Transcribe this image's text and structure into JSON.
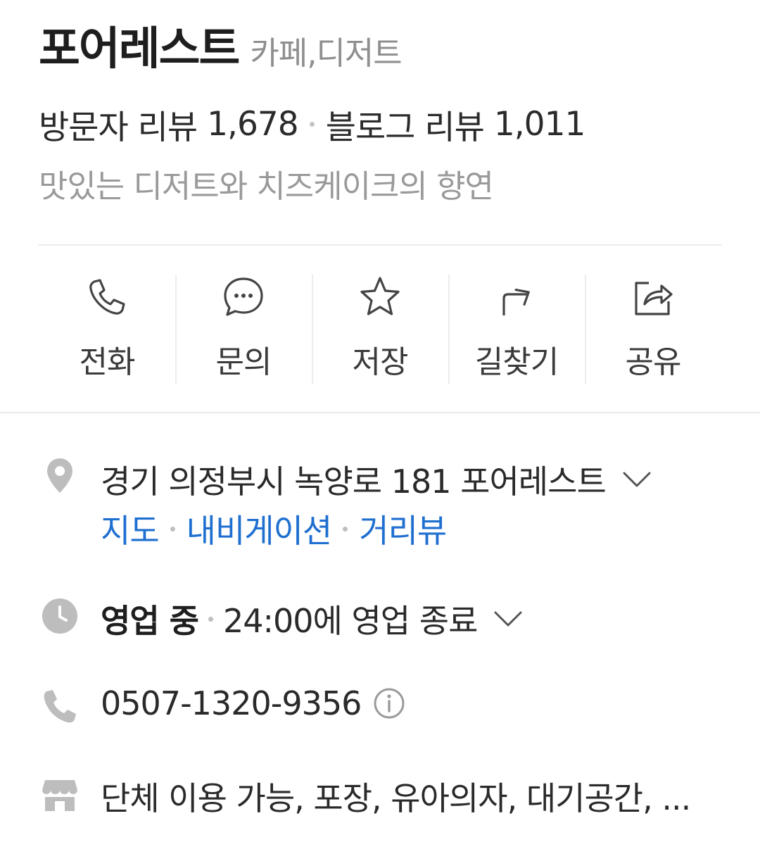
{
  "header": {
    "name": "포어레스트",
    "category": "카페,디저트",
    "visitor_review_label": "방문자 리뷰",
    "visitor_review_count": "1,678",
    "blog_review_label": "블로그 리뷰",
    "blog_review_count": "1,011",
    "description": "맛있는 디저트와 치즈케이크의 향연"
  },
  "actions": [
    {
      "label": "전화",
      "icon": "phone-icon"
    },
    {
      "label": "문의",
      "icon": "chat-bubble-icon"
    },
    {
      "label": "저장",
      "icon": "star-icon"
    },
    {
      "label": "길찾기",
      "icon": "directions-arrow-icon"
    },
    {
      "label": "공유",
      "icon": "share-icon"
    }
  ],
  "info": {
    "address": "경기 의정부시 녹양로 181 포어레스트",
    "links": [
      "지도",
      "내비게이션",
      "거리뷰"
    ],
    "hours_status": "영업 중",
    "hours_detail": "24:00에 영업 종료",
    "phone": "0507-1320-9356",
    "amenities": "단체 이용 가능, 포장, 유아의자, 대기공간, ..."
  },
  "colors": {
    "link": "#1f6fd0",
    "icon_gray": "#bdbdbd",
    "text": "#222222"
  }
}
